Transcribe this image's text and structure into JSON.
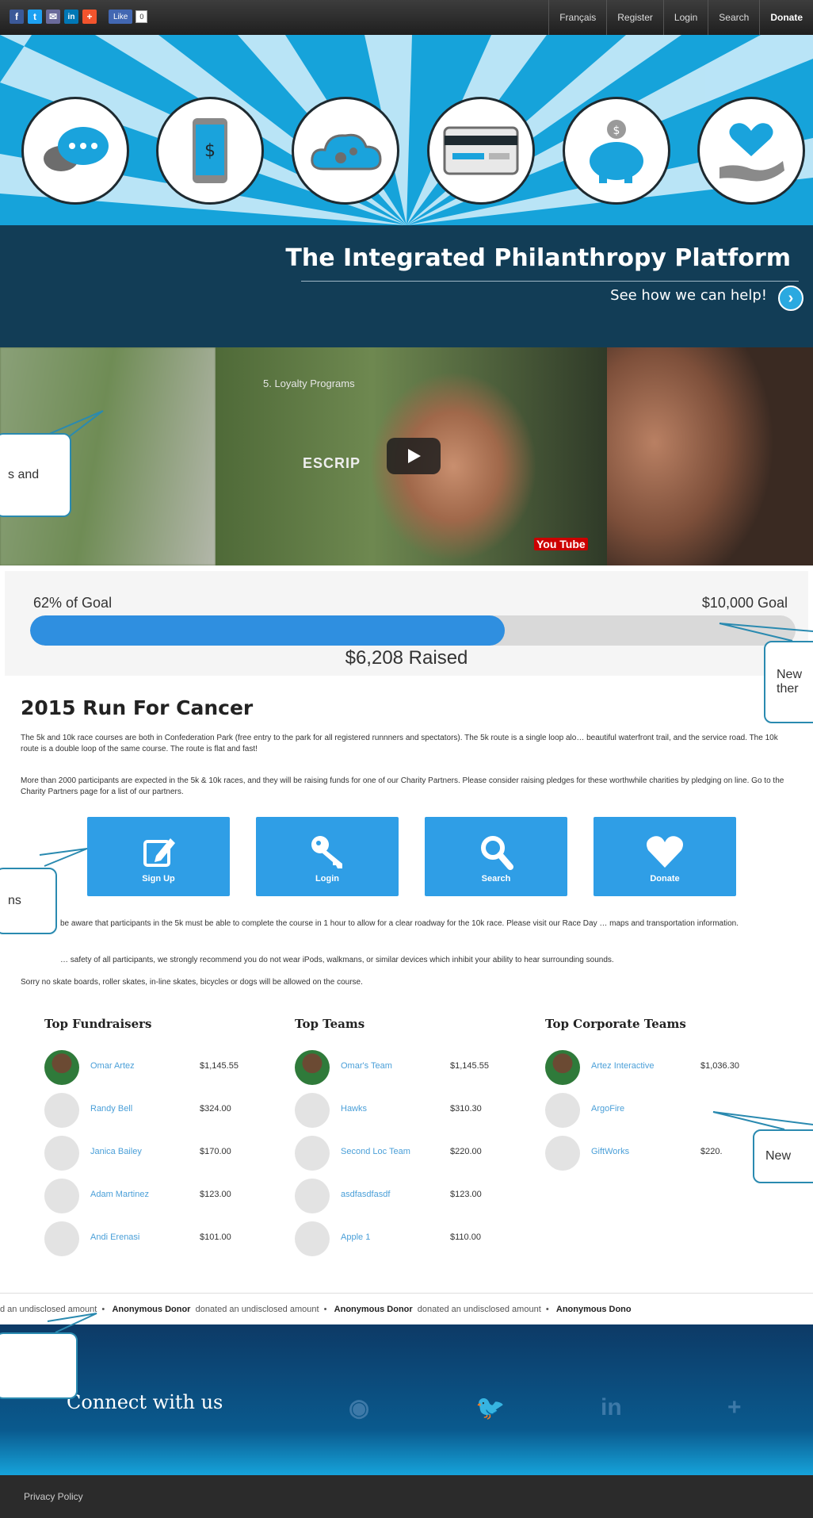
{
  "topbar": {
    "share_icons": [
      "facebook-icon",
      "twitter-icon",
      "email-icon",
      "linkedin-icon",
      "addthis-icon"
    ],
    "share_glyphs": [
      "f",
      "t",
      "✉",
      "in",
      "+"
    ],
    "fb_like": "Like",
    "fb_count": "0",
    "nav": [
      "Français",
      "Register",
      "Login",
      "Search",
      "Donate"
    ]
  },
  "hero": {
    "title": "The Integrated Philanthropy Platform",
    "cta": "See how we can help!"
  },
  "video": {
    "caption": "5. Loyalty Programs",
    "sign": "ESCRIP",
    "logo": "You Tube"
  },
  "progress": {
    "percent_label": "62% of Goal",
    "goal_label": "$10,000 Goal",
    "raised_label": "$6,208 Raised",
    "fraction": 0.62
  },
  "event": {
    "title": "2015 Run For Cancer",
    "p1": "The 5k and 10k race courses are both in Confederation Park (free entry to the park for all registered runnners and spectators). The 5k route is a single loop alo… beautiful waterfront trail, and the service road. The 10k route is a double loop of the same course. The route is flat and fast!",
    "p2": "More than 2000 participants are expected in the 5k & 10k races, and they will be raising funds for one of our Charity Partners. Please consider raising pledges for these worthwhile charities by pledging on line. Go to the Charity Partners page for a list of our partners.",
    "p3": "be aware that participants in the 5k must be able to complete the course in 1 hour to allow for a clear roadway for the 10k race. Please visit our Race Day … maps and transportation information.",
    "p4": "… safety of all participants, we strongly recommend you do not wear iPods, walkmans, or similar devices which inhibit your ability to hear surrounding sounds.",
    "p5": "Sorry no skate boards, roller skates, in-line skates, bicycles or dogs will be allowed on the course."
  },
  "actions": [
    {
      "label": "Sign Up",
      "icon": "edit-icon"
    },
    {
      "label": "Login",
      "icon": "key-icon"
    },
    {
      "label": "Search",
      "icon": "search-icon"
    },
    {
      "label": "Donate",
      "icon": "heart-icon"
    }
  ],
  "boards": [
    {
      "title": "Top Fundraisers",
      "rows": [
        {
          "name": "Omar Artez",
          "amount": "$1,145.55"
        },
        {
          "name": "Randy Bell",
          "amount": "$324.00"
        },
        {
          "name": "Janica Bailey",
          "amount": "$170.00"
        },
        {
          "name": "Adam Martinez",
          "amount": "$123.00"
        },
        {
          "name": "Andi Erenasi",
          "amount": "$101.00"
        }
      ]
    },
    {
      "title": "Top Teams",
      "rows": [
        {
          "name": "Omar's Team",
          "amount": "$1,145.55"
        },
        {
          "name": "Hawks",
          "amount": "$310.30"
        },
        {
          "name": "Second Loc Team",
          "amount": "$220.00"
        },
        {
          "name": "asdfasdfasdf",
          "amount": "$123.00"
        },
        {
          "name": "Apple 1",
          "amount": "$110.00"
        }
      ]
    },
    {
      "title": "Top Corporate Teams",
      "rows": [
        {
          "name": "Artez Interactive",
          "amount": "$1,036.30"
        },
        {
          "name": "ArgoFire",
          "amount": ""
        },
        {
          "name": "GiftWorks",
          "amount": "$220."
        }
      ]
    }
  ],
  "ticker": {
    "lead": "d an undisclosed amount",
    "donor": "Anonymous Donor",
    "text": "donated an undisclosed amount",
    "tail": "Anonymous Dono"
  },
  "footer": {
    "connect": "Connect with us",
    "social_icons": [
      "github-icon",
      "twitter-icon",
      "linkedin-icon",
      "addthis-icon"
    ],
    "social_glyphs": [
      "◉",
      "🐦",
      "in",
      "+"
    ],
    "privacy": "Privacy Policy"
  },
  "callouts": [
    "s and",
    "New",
    "ther",
    "ns",
    "New"
  ],
  "colors": {
    "accent": "#2f8fe0",
    "tile": "#2f9ee6",
    "band": "#123d56",
    "hero": "#16a3da"
  }
}
